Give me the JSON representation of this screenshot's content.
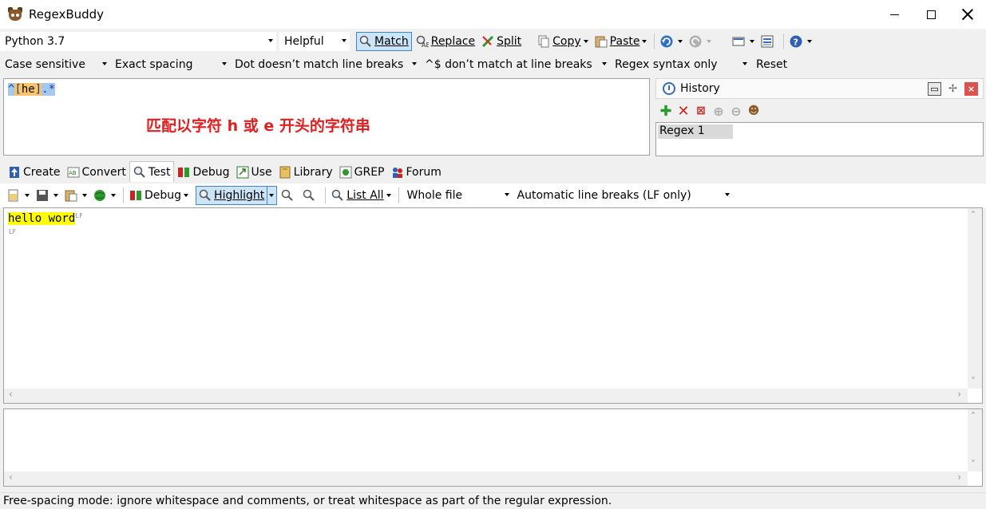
{
  "window": {
    "title": "RegexBuddy"
  },
  "toolbar1": {
    "flavor": "Python 3.7",
    "helpfulness": "Helpful",
    "match": "Match",
    "replace": "Replace",
    "split": "Split",
    "copy": "Copy",
    "paste": "Paste"
  },
  "toolbar2": {
    "case": "Case sensitive",
    "spacing": "Exact spacing",
    "dot": "Dot doesn’t match line breaks",
    "anchors": "^$ don’t match at line breaks",
    "syntax": "Regex syntax only",
    "reset": "Reset"
  },
  "regex": {
    "caret": "^",
    "open_bracket": "[",
    "class_chars": "he",
    "close_bracket": "]",
    "dot_star": ".*",
    "annotation": "匹配以字符 h 或 e 开头的字符串"
  },
  "history": {
    "title": "History",
    "items": [
      "Regex 1"
    ]
  },
  "tabs": [
    "Create",
    "Convert",
    "Test",
    "Debug",
    "Use",
    "Library",
    "GREP",
    "Forum"
  ],
  "test_toolbar": {
    "debug": "Debug",
    "highlight": "Highlight",
    "list_all": "List All",
    "scope": "Whole file",
    "line_breaks": "Automatic line breaks (LF only)"
  },
  "test_subject": {
    "line1": "hello word",
    "lb_mark": "LF"
  },
  "status": "Free-spacing mode: ignore whitespace and comments, or treat whitespace as part of the regular expression.",
  "colors": {
    "match_highlight": "#ffff00",
    "annotation": "#e02020",
    "pressed_button": "#cce4f7"
  }
}
